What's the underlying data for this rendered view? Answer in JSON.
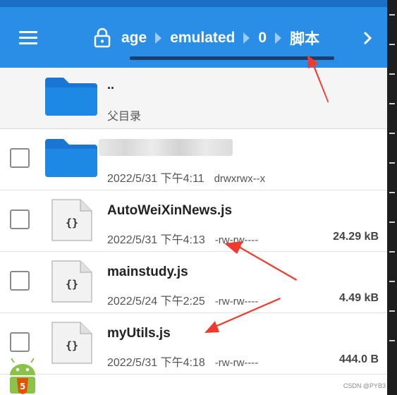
{
  "header": {
    "breadcrumbs": [
      "age",
      "emulated",
      "0",
      "脚本"
    ],
    "active_crumb": "脚本"
  },
  "parent_entry": {
    "name": "..",
    "label": "父目录"
  },
  "files": [
    {
      "type": "folder",
      "name": "",
      "date": "2022/5/31 下午4:11",
      "perm": "drwxrwx--x",
      "size": ""
    },
    {
      "type": "file",
      "name": "AutoWeiXinNews.js",
      "date": "2022/5/31 下午4:13",
      "perm": "-rw-rw----",
      "size": "24.29 kB"
    },
    {
      "type": "file",
      "name": "mainstudy.js",
      "date": "2022/5/24 下午2:25",
      "perm": "-rw-rw----",
      "size": "4.49 kB"
    },
    {
      "type": "file",
      "name": "myUtils.js",
      "date": "2022/5/31 下午4:18",
      "perm": "-rw-rw----",
      "size": "444.0 B"
    }
  ],
  "watermark": "CSDN @PYB3",
  "colors": {
    "header": "#2a8ee6",
    "folder": "#1976d2",
    "annotation": "#f03a2e"
  },
  "icons": [
    "menu-icon",
    "lock-icon",
    "chevron-right-icon",
    "folder-icon",
    "js-file-icon",
    "android-icon"
  ]
}
